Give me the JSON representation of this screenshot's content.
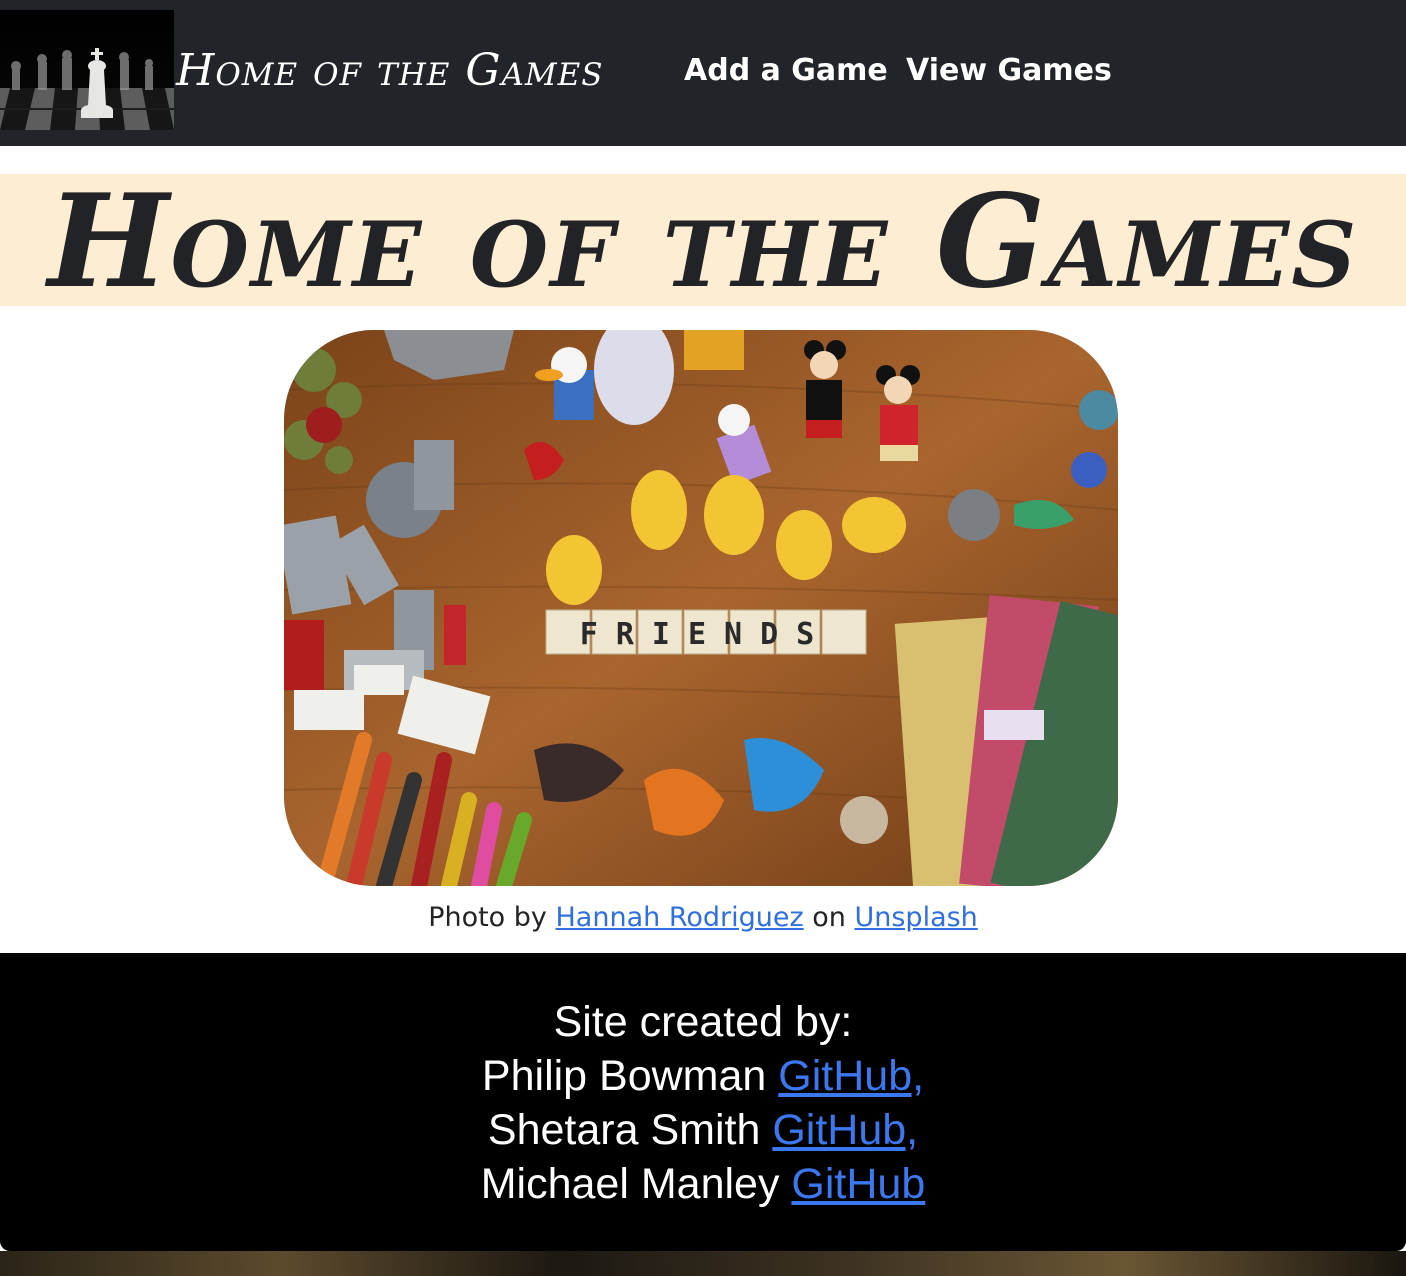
{
  "navbar": {
    "logo_icon": "chess-king-logo",
    "brand": "Home of the Games",
    "links": [
      "Add a Game",
      "View Games"
    ]
  },
  "hero": {
    "title": "Home of the Games"
  },
  "photo": {
    "scrabble_word": "FRIENDS",
    "credit_prefix": "Photo by",
    "credit_author": "Hannah Rodriguez",
    "credit_middle": "on",
    "credit_site": "Unsplash"
  },
  "footer": {
    "heading": "Site created by:",
    "creators": [
      {
        "name": "Philip Bowman",
        "link": "GitHub,"
      },
      {
        "name": "Shetara Smith",
        "link": "GitHub,"
      },
      {
        "name": "Michael Manley",
        "link": "GitHub"
      }
    ]
  },
  "colors": {
    "navbar_bg": "#212529",
    "hero_band": "#fdeed3",
    "link": "#2f6fe0",
    "footer_bg": "#000000"
  }
}
